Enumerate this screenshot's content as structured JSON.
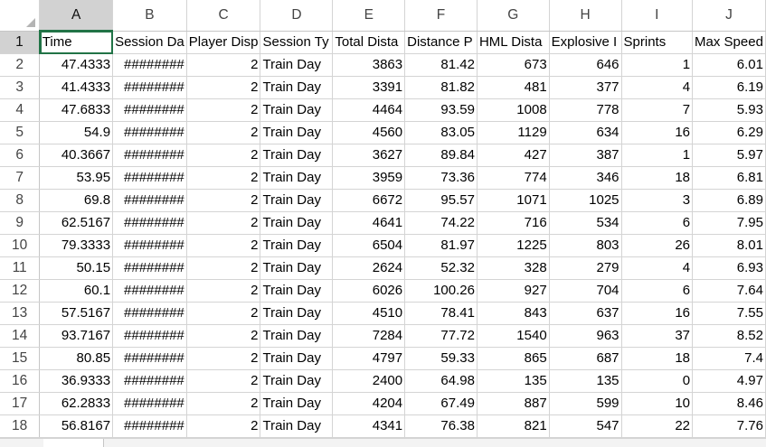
{
  "columns": [
    "A",
    "B",
    "C",
    "D",
    "E",
    "F",
    "G",
    "H",
    "I",
    "J"
  ],
  "active_cell": "A1",
  "header_row": {
    "row_num": "1",
    "cells": [
      "Time",
      "Session Da",
      "Player Disp",
      "Session Ty",
      "Total Dista",
      "Distance P",
      "HML Dista",
      "Explosive I",
      "Sprints",
      "Max Speed"
    ]
  },
  "rows": [
    {
      "n": "2",
      "v": [
        "47.4333",
        "########",
        "2",
        "Train Day",
        "3863",
        "81.42",
        "673",
        "646",
        "1",
        "6.01"
      ]
    },
    {
      "n": "3",
      "v": [
        "41.4333",
        "########",
        "2",
        "Train Day",
        "3391",
        "81.82",
        "481",
        "377",
        "4",
        "6.19"
      ]
    },
    {
      "n": "4",
      "v": [
        "47.6833",
        "########",
        "2",
        "Train Day",
        "4464",
        "93.59",
        "1008",
        "778",
        "7",
        "5.93"
      ]
    },
    {
      "n": "5",
      "v": [
        "54.9",
        "########",
        "2",
        "Train Day",
        "4560",
        "83.05",
        "1129",
        "634",
        "16",
        "6.29"
      ]
    },
    {
      "n": "6",
      "v": [
        "40.3667",
        "########",
        "2",
        "Train Day",
        "3627",
        "89.84",
        "427",
        "387",
        "1",
        "5.97"
      ]
    },
    {
      "n": "7",
      "v": [
        "53.95",
        "########",
        "2",
        "Train Day",
        "3959",
        "73.36",
        "774",
        "346",
        "18",
        "6.81"
      ]
    },
    {
      "n": "8",
      "v": [
        "69.8",
        "########",
        "2",
        "Train Day",
        "6672",
        "95.57",
        "1071",
        "1025",
        "3",
        "6.89"
      ]
    },
    {
      "n": "9",
      "v": [
        "62.5167",
        "########",
        "2",
        "Train Day",
        "4641",
        "74.22",
        "716",
        "534",
        "6",
        "7.95"
      ]
    },
    {
      "n": "10",
      "v": [
        "79.3333",
        "########",
        "2",
        "Train Day",
        "6504",
        "81.97",
        "1225",
        "803",
        "26",
        "8.01"
      ]
    },
    {
      "n": "11",
      "v": [
        "50.15",
        "########",
        "2",
        "Train Day",
        "2624",
        "52.32",
        "328",
        "279",
        "4",
        "6.93"
      ]
    },
    {
      "n": "12",
      "v": [
        "60.1",
        "########",
        "2",
        "Train Day",
        "6026",
        "100.26",
        "927",
        "704",
        "6",
        "7.64"
      ]
    },
    {
      "n": "13",
      "v": [
        "57.5167",
        "########",
        "2",
        "Train Day",
        "4510",
        "78.41",
        "843",
        "637",
        "16",
        "7.55"
      ]
    },
    {
      "n": "14",
      "v": [
        "93.7167",
        "########",
        "2",
        "Train Day",
        "7284",
        "77.72",
        "1540",
        "963",
        "37",
        "8.52"
      ]
    },
    {
      "n": "15",
      "v": [
        "80.85",
        "########",
        "2",
        "Train Day",
        "4797",
        "59.33",
        "865",
        "687",
        "18",
        "7.4"
      ]
    },
    {
      "n": "16",
      "v": [
        "36.9333",
        "########",
        "2",
        "Train Day",
        "2400",
        "64.98",
        "135",
        "135",
        "0",
        "4.97"
      ]
    },
    {
      "n": "17",
      "v": [
        "62.2833",
        "########",
        "2",
        "Train Day",
        "4204",
        "67.49",
        "887",
        "599",
        "10",
        "8.46"
      ]
    },
    {
      "n": "18",
      "v": [
        "56.8167",
        "########",
        "2",
        "Train Day",
        "4341",
        "76.38",
        "821",
        "547",
        "22",
        "7.76"
      ]
    }
  ]
}
